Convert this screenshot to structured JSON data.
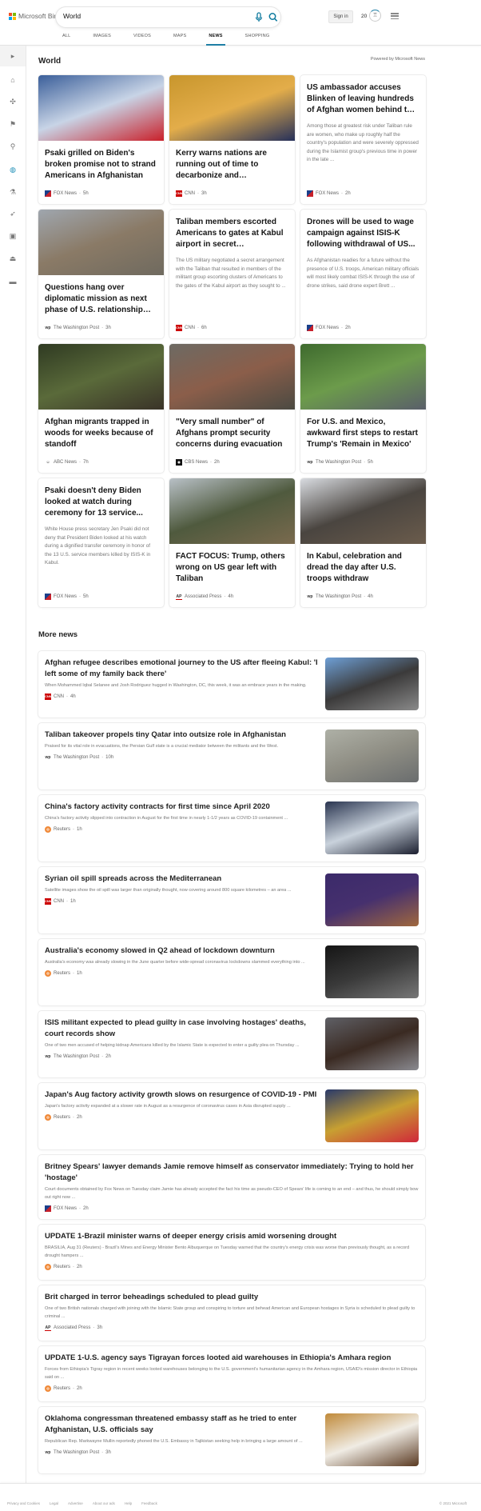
{
  "header": {
    "logo_text": "Microsoft Bing",
    "search_value": "World",
    "tabs": [
      "ALL",
      "IMAGES",
      "VIDEOS",
      "MAPS",
      "NEWS",
      "SHOPPING"
    ],
    "active_tab": "NEWS",
    "sign_in": "Sign in",
    "points": "20",
    "accent": "#1f7fa6"
  },
  "sidebar": {
    "icons": [
      "expand-arrow-icon",
      "home-icon",
      "satellite-icon",
      "flag-icon",
      "location-pin-icon",
      "globe-icon",
      "microscope-icon",
      "rocket-icon",
      "film-icon",
      "bank-icon",
      "credit-card-icon"
    ],
    "active": "globe-icon"
  },
  "world": {
    "title": "World",
    "powered_by": "Powered by Microsoft News",
    "cards": [
      {
        "title": "Psaki grilled on Biden's broken promise not to strand Americans in Afghanistan",
        "source": "FOX News",
        "time": "5h",
        "logo": "fox",
        "image": [
          "#3b5f9a",
          "#c8d4e6",
          "#c9202a"
        ]
      },
      {
        "title": "Kerry warns nations are running out of time to decarbonize and challenges...",
        "source": "CNN",
        "time": "3h",
        "logo": "cnn",
        "image": [
          "#c8962d",
          "#e3ad4a",
          "#26305a"
        ]
      },
      {
        "title": "US ambassador accuses Blinken of leaving hundreds of Afghan women behind to die i...",
        "snippet": "Among those at greatest risk under Taliban rule are women, who make up roughly half the country's population and were severely oppressed during the Islamist group's previous time in power in the late ...",
        "source": "FOX News",
        "time": "2h",
        "logo": "fox"
      },
      {
        "title": "Questions hang over diplomatic mission as next phase of U.S. relationship with Afghanistan...",
        "source": "The Washington Post",
        "time": "3h",
        "logo": "wp",
        "image": [
          "#9fa6ae",
          "#8a7a66",
          "#6f6a5f"
        ]
      },
      {
        "title": "Taliban members escorted Americans to gates at Kabul airport in secret arrangement...",
        "snippet": "The US military negotiated a secret arrangement with the Taliban that resulted in members of the militant group escorting clusters of Americans to the gates of the Kabul airport as they sought to ...",
        "source": "CNN",
        "time": "6h",
        "logo": "cnn"
      },
      {
        "title": "Drones will be used to wage campaign against ISIS-K following withdrawal of US...",
        "snippet": "As Afghanistan readies for a future without the presence of U.S. troops, American military officials will most likely combat ISIS-K through the use of drone strikes, said drone expert Brett ...",
        "source": "FOX News",
        "time": "2h",
        "logo": "fox"
      },
      {
        "title": "Afghan migrants trapped in woods for weeks because of standoff",
        "source": "ABC News",
        "time": "7h",
        "logo": "abc",
        "image": [
          "#2f3a22",
          "#5a6a3a",
          "#3a3328"
        ]
      },
      {
        "title": "\"Very small number\" of Afghans prompt security concerns during evacuation",
        "source": "CBS News",
        "time": "2h",
        "logo": "cbs",
        "image": [
          "#6d6a63",
          "#8b5e4a",
          "#4b4a42"
        ]
      },
      {
        "title": "For U.S. and Mexico, awkward first steps to restart Trump's 'Remain in Mexico'",
        "source": "The Washington Post",
        "time": "5h",
        "logo": "wp",
        "image": [
          "#3e6a2e",
          "#6c9b4b",
          "#5a5f6a"
        ]
      },
      {
        "title": "Psaki doesn't deny Biden looked at watch during ceremony for 13 service...",
        "snippet": "White House press secretary Jen Psaki did not deny that President Biden looked at his watch during a dignified transfer ceremony in honor of the 13 U.S. service members killed by ISIS-K in Kabul.",
        "source": "FOX News",
        "time": "5h",
        "logo": "fox"
      },
      {
        "title": "FACT FOCUS: Trump, others wrong on US gear left with Taliban",
        "source": "Associated Press",
        "time": "4h",
        "logo": "ap",
        "image": [
          "#b8c0c6",
          "#4f5a3e",
          "#7a6a4e"
        ]
      },
      {
        "title": "In Kabul, celebration and dread the day after U.S. troops withdraw",
        "source": "The Washington Post",
        "time": "4h",
        "logo": "wp",
        "image": [
          "#d8dbe0",
          "#4a4540",
          "#6b5c4c"
        ]
      }
    ]
  },
  "more_news": {
    "title": "More news",
    "items": [
      {
        "title": "Afghan refugee describes emotional journey to the US after fleeing Kabul: 'I left some of my family back there'",
        "snippet": "When Mohammed Iqbal Selanee and Josh Rodriguez hugged in Washington, DC, this week, it was an embrace years in the making.",
        "source": "CNN",
        "time": "4h",
        "logo": "cnn",
        "image": [
          "#6e9fd6",
          "#3b3a3a",
          "#8a8a8a"
        ]
      },
      {
        "title": "Taliban takeover propels tiny Qatar into outsize role in Afghanistan",
        "snippet": "Praised for its vital role in evacuations, the Persian Gulf state is a crucial mediator between the militants and the West.",
        "source": "The Washington Post",
        "time": "10h",
        "logo": "wp",
        "image": [
          "#aeb0a6",
          "#8f8e84",
          "#6a6d6e"
        ]
      },
      {
        "title": "China's factory activity contracts for first time since April 2020",
        "snippet": "China's factory activity slipped into contraction in August for the first time in nearly 1-1/2 years as COVID-19 containment ...",
        "source": "Reuters",
        "time": "1h",
        "logo": "reuters",
        "image": [
          "#2a3550",
          "#c9d2dc",
          "#1c2030"
        ]
      },
      {
        "title": "Syrian oil spill spreads across the Mediterranean",
        "snippet": "Satellite images show the oil spill was larger than originally thought, now covering around 800 square kilometres – an area ...",
        "source": "CNN",
        "time": "1h",
        "logo": "cnn",
        "image": [
          "#3b2a6a",
          "#46306e",
          "#a0683e"
        ]
      },
      {
        "title": "Australia's economy slowed in Q2 ahead of lockdown downturn",
        "snippet": "Australia's economy was already slowing in the June quarter before wide-spread coronavirus lockdowns slammed everything into ...",
        "source": "Reuters",
        "time": "1h",
        "logo": "reuters",
        "image": [
          "#151515",
          "#3a3a3a",
          "#777777"
        ]
      },
      {
        "title": "ISIS militant expected to plead guilty in case involving hostages' deaths, court records show",
        "snippet": "One of two men accused of helping kidnap Americans killed by the Islamic State is expected to enter a guilty plea on Thursday ...",
        "source": "The Washington Post",
        "time": "2h",
        "logo": "wp",
        "image": [
          "#5f6066",
          "#3a2a22",
          "#8a8a90"
        ]
      },
      {
        "title": "Japan's Aug factory activity growth slows on resurgence of COVID-19 - PMI",
        "snippet": "Japan's factory activity expanded at a slower rate in August as a resurgence of coronavirus cases in Asia disrupted supply ...",
        "source": "Reuters",
        "time": "2h",
        "logo": "reuters",
        "image": [
          "#2a3a6a",
          "#c8a032",
          "#d0283a"
        ]
      },
      {
        "title": "Britney Spears' lawyer demands Jamie remove himself as conservator immediately: Trying to hold her 'hostage'",
        "snippet": "Court documents obtained by Fox News on Tuesday claim Jamie has already accepted the fact his time as pseudo-CEO of Spears' life is coming to an end – and thus, he should simply bow out right now ...",
        "source": "FOX News",
        "time": "2h",
        "logo": "fox"
      },
      {
        "title": "UPDATE 1-Brazil minister warns of deeper energy crisis amid worsening drought",
        "snippet": "BRASILIA, Aug 31 (Reuters) - Brazil's Mines and Energy Minister Bento Albuquerque on Tuesday warned that the country's energy crisis was worse than previously thought, as a record drought hampers ...",
        "source": "Reuters",
        "time": "2h",
        "logo": "reuters"
      },
      {
        "title": "Brit charged in terror beheadings scheduled to plead guilty",
        "snippet": "One of two British nationals charged with joining with the Islamic State group and conspiring to torture and behead American and European hostages in Syria is scheduled to plead guilty to criminal ...",
        "source": "Associated Press",
        "time": "3h",
        "logo": "ap"
      },
      {
        "title": "UPDATE 1-U.S. agency says Tigrayan forces looted aid warehouses in Ethiopia's Amhara region",
        "snippet": "Forces from Ethiopia's Tigray region in recent weeks looted warehouses belonging to the U.S. government's humanitarian agency in the Amhara region, USAID's mission director in Ethiopia said on ...",
        "source": "Reuters",
        "time": "2h",
        "logo": "reuters"
      },
      {
        "title": "Oklahoma congressman threatened embassy staff as he tried to enter Afghanistan, U.S. officials say",
        "snippet": "Republican Rep. Markwayne Mullin reportedly phoned the U.S. Embassy in Tajikistan seeking help in bringing a large amount of ...",
        "source": "The Washington Post",
        "time": "3h",
        "logo": "wp",
        "image": [
          "#c08a3a",
          "#f0ece4",
          "#5a3a22"
        ]
      }
    ]
  },
  "footer": {
    "links": [
      "Privacy and Cookies",
      "Legal",
      "Advertise",
      "About our ads",
      "Help",
      "Feedback"
    ],
    "copyright": "© 2021 Microsoft"
  }
}
